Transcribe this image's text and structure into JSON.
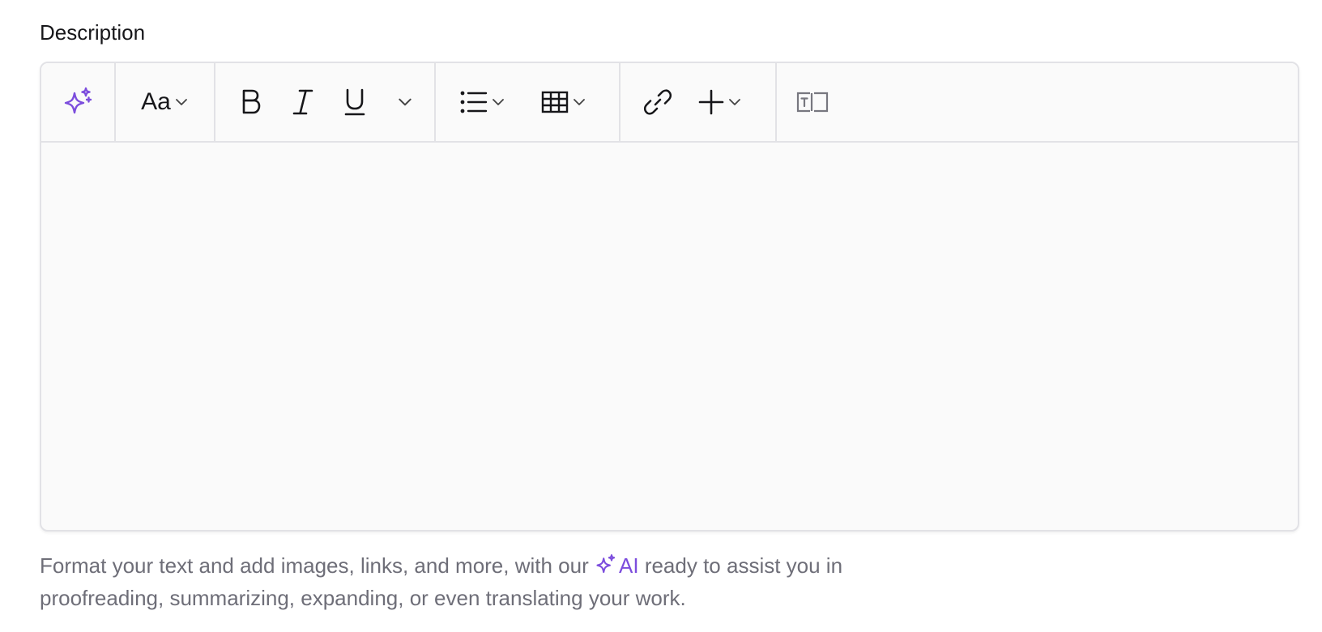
{
  "field": {
    "label": "Description"
  },
  "toolbar": {
    "ai_icon": "sparkles-icon",
    "text_style_label": "Aa",
    "bold_icon": "bold-icon",
    "italic_icon": "italic-icon",
    "underline_icon": "underline-icon",
    "list_icon": "bulleted-list-icon",
    "table_icon": "table-icon",
    "link_icon": "link-icon",
    "insert_icon": "plus-icon",
    "text_field_icon": "text-field-icon"
  },
  "editor": {
    "content": ""
  },
  "help": {
    "before": "Format your text and add images, links, and more, with our",
    "ai_label": "AI",
    "after": "ready to assist you in proofreading, summarizing, expanding, or even translating your work."
  },
  "colors": {
    "accent": "#7c4ddd",
    "border": "#e2e2e6",
    "editor_bg": "#fafafa",
    "help_text": "#6e6e78"
  }
}
